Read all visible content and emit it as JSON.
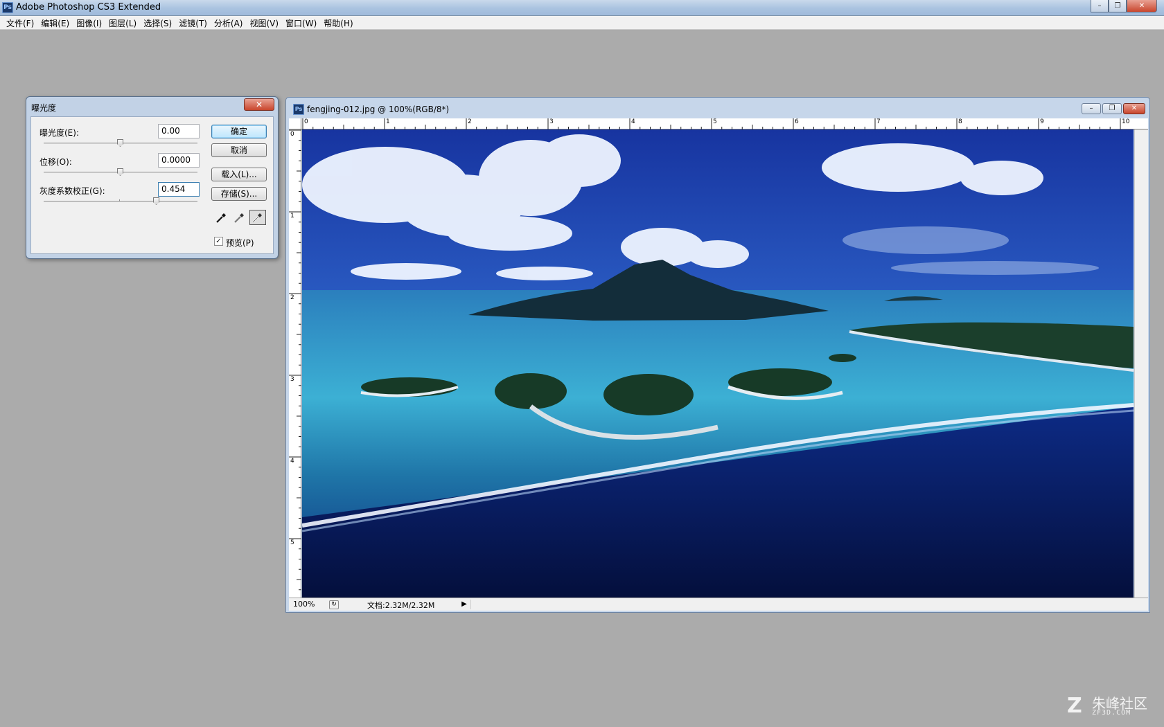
{
  "app": {
    "logo": "Ps",
    "title": "Adobe Photoshop CS3 Extended",
    "window_buttons": [
      "–",
      "❐",
      "✕"
    ]
  },
  "menubar": {
    "items": [
      "文件(F)",
      "编辑(E)",
      "图像(I)",
      "图层(L)",
      "选择(S)",
      "滤镜(T)",
      "分析(A)",
      "视图(V)",
      "窗口(W)",
      "帮助(H)"
    ]
  },
  "dialog": {
    "title": "曝光度",
    "close_label": "✕",
    "exposure": {
      "label": "曝光度(E):",
      "value": "0.00",
      "slider_pos": 0.5
    },
    "offset": {
      "label": "位移(O):",
      "value": "0.0000",
      "slider_pos": 0.5
    },
    "gamma": {
      "label": "灰度系数校正(G):",
      "value": "0.454",
      "slider_pos": 0.72
    },
    "buttons": {
      "ok": "确定",
      "cancel": "取消",
      "load": "载入(L)...",
      "save": "存储(S)..."
    },
    "eyedroppers": [
      "black-point-eyedropper-icon",
      "gray-point-eyedropper-icon",
      "white-point-eyedropper-icon"
    ],
    "preview": {
      "label": "预览(P)",
      "checked": true,
      "check_glyph": "✓"
    }
  },
  "document": {
    "icon": "Ps",
    "title": "fengjing-012.jpg @ 100%(RGB/8*)",
    "buttons": [
      "–",
      "❐",
      "✕"
    ],
    "ruler_top": [
      "0",
      "1",
      "2",
      "3",
      "4",
      "5",
      "6",
      "7",
      "8",
      "9",
      "10"
    ],
    "ruler_left": [
      "0",
      "1",
      "2",
      "3",
      "4",
      "5"
    ],
    "status": {
      "zoom": "100%",
      "doc_info": "文档:2.32M/2.32M",
      "arrow": "▶"
    }
  },
  "watermark": {
    "mark": "Z",
    "text": "朱峰社区",
    "subtext": "ZF3D.COM"
  },
  "colors": {
    "workspace": "#ababab",
    "titlebar": "#aac3e0",
    "close_red": "#c9452c",
    "sky_blue": "#1f4ab4",
    "lagoon": "#3ba6cc"
  }
}
